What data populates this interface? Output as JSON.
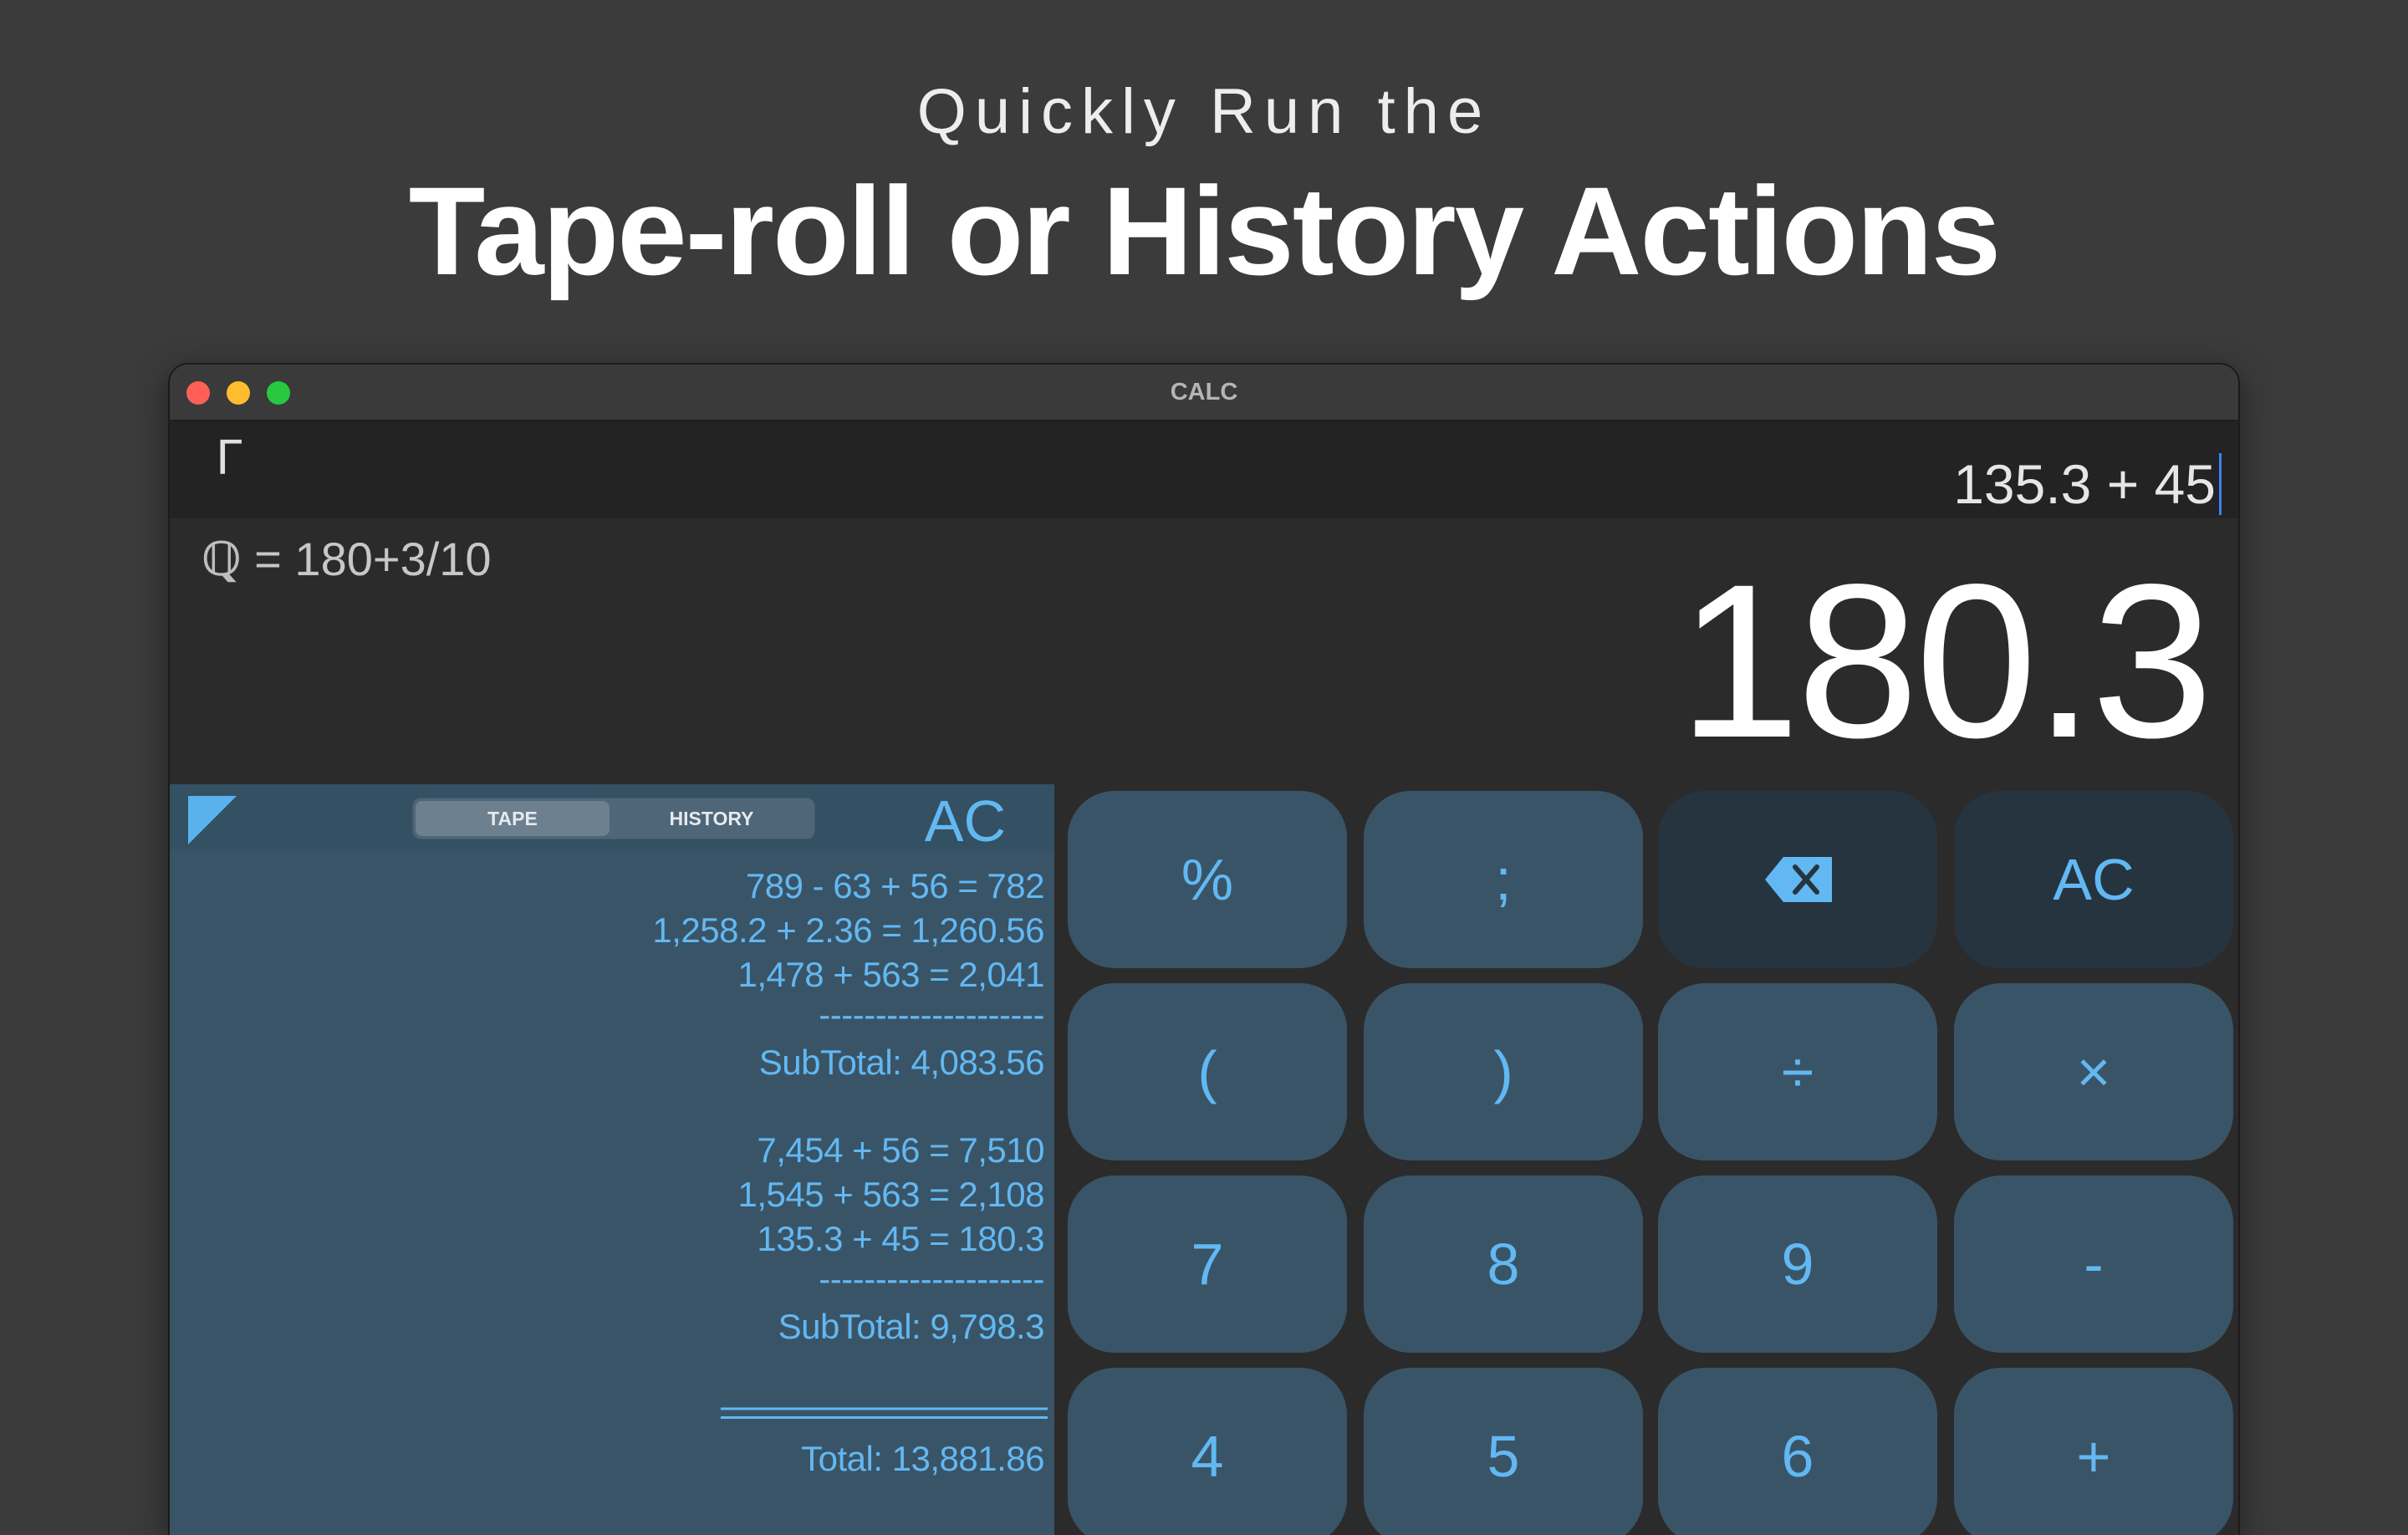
{
  "headline": {
    "sub": "Quickly Run the",
    "main": "Tape-roll or History Actions"
  },
  "window": {
    "title": "CALC"
  },
  "input": {
    "corner_glyph": "Γ",
    "expression": "135.3 + 45"
  },
  "display": {
    "fraction_icon": "ℚ",
    "fraction_text": " = 180+3/10",
    "result": "180.3"
  },
  "tape": {
    "tabs": [
      "TAPE",
      "HISTORY"
    ],
    "selected_tab": "TAPE",
    "ac_label": "AC",
    "lines": [
      "789 - 63 + 56 = 782",
      "1,258.2 + 2.36 = 1,260.56",
      "1,478 + 563 = 2,041",
      "--------------------",
      "SubTotal: 4,083.56",
      "7,454 + 56 = 7,510",
      "1,545 + 563 = 2,108",
      "135.3 + 45 = 180.3",
      "--------------------",
      "SubTotal: 9,798.3",
      "=====================",
      "Total: 13,881.86"
    ]
  },
  "keypad": {
    "keys": [
      {
        "label": "%",
        "style": "normal"
      },
      {
        "label": ";",
        "style": "normal"
      },
      {
        "label": "",
        "style": "dark",
        "icon": "backspace-icon"
      },
      {
        "label": "AC",
        "style": "dark"
      },
      {
        "label": "(",
        "style": "normal"
      },
      {
        "label": ")",
        "style": "normal"
      },
      {
        "label": "÷",
        "style": "normal"
      },
      {
        "label": "×",
        "style": "normal"
      },
      {
        "label": "7",
        "style": "normal"
      },
      {
        "label": "8",
        "style": "normal"
      },
      {
        "label": "9",
        "style": "normal"
      },
      {
        "label": "-",
        "style": "normal"
      },
      {
        "label": "4",
        "style": "normal"
      },
      {
        "label": "5",
        "style": "normal"
      },
      {
        "label": "6",
        "style": "normal"
      },
      {
        "label": "+",
        "style": "normal"
      }
    ]
  },
  "colors": {
    "accent": "#62b8f2",
    "tape_background": "#3a5467",
    "key_background": "#3a5467",
    "key_dark_background": "#263440",
    "page_background": "#3b3b3b"
  }
}
